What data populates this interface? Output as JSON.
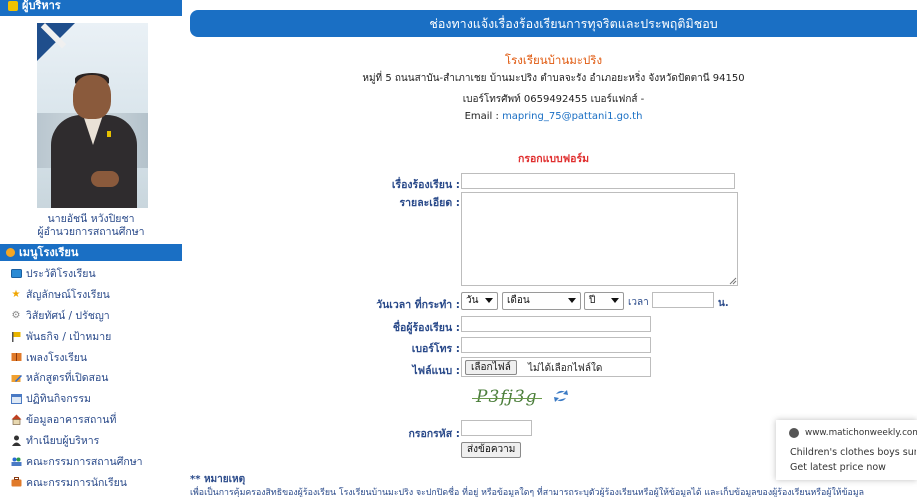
{
  "sidebar": {
    "admin_header": "ผู้บริหาร",
    "director_name": "นายอัชนี หวังปิยชา",
    "director_title": "ผู้อำนวยการสถานศึกษา",
    "menu_header": "เมนูโรงเรียน",
    "menu_items": [
      {
        "label": "ประวัติโรงเรียน",
        "icon": "card-icon"
      },
      {
        "label": "สัญลักษณ์โรงเรียน",
        "icon": "star-icon"
      },
      {
        "label": "วิสัยทัศน์ / ปรัชญา",
        "icon": "gear-icon"
      },
      {
        "label": "พันธกิจ / เป้าหมาย",
        "icon": "flag-icon"
      },
      {
        "label": "เพลงโรงเรียน",
        "icon": "music-book-icon"
      },
      {
        "label": "หลักสูตรที่เปิดสอน",
        "icon": "pencil-icon"
      },
      {
        "label": "ปฏิทินกิจกรรม",
        "icon": "calendar-icon"
      },
      {
        "label": "ข้อมูลอาคารสถานที่",
        "icon": "house-icon"
      },
      {
        "label": "ทำเนียบผู้บริหาร",
        "icon": "person-icon"
      },
      {
        "label": "คณะกรรมการสถานศึกษา",
        "icon": "group-icon"
      },
      {
        "label": "คณะกรรมการนักเรียน",
        "icon": "briefcase-icon"
      }
    ]
  },
  "banner": {
    "title": "ช่องทางแจ้งเรื่องร้องเรียนการทุจริตและประพฤติมิชอบ"
  },
  "school": {
    "name": "โรงเรียนบ้านมะปริง",
    "address": "หมู่ที่ 5 ถนนสาบัน-สำเภาเชย บ้านมะปริง ตำบลจะรัง อำเภอยะหริ่ง จังหวัดปัตตานี 94150",
    "phone": "เบอร์โทรศัพท์ 0659492455 เบอร์แฟกส์ -",
    "email_label": "Email :",
    "email": "mapring_75@pattani1.go.th"
  },
  "form": {
    "title": "กรอกแบบฟอร์ม",
    "subject_label": "เรื่องร้องเรียน :",
    "subject_value": "",
    "details_label": "รายละเอียด :",
    "details_value": "",
    "datetime_label": "วันเวลา ที่กระทำ :",
    "day_value": "วัน",
    "month_value": "เดือน",
    "year_value": "ปี",
    "time_label": "เวลา",
    "time_value": "",
    "time_unit": "น.",
    "name_label": "ชื่อผู้ร้องเรียน :",
    "name_value": "",
    "phone_label": "เบอร์โทร :",
    "phone_value": "",
    "attachment_label": "ไฟล์แนบ :",
    "file_button": "เลือกไฟล์",
    "file_status": "ไม่ได้เลือกไฟล์ใด",
    "captcha_text": "P3fj3g",
    "code_label": "กรอกรหัส :",
    "code_value": "",
    "submit_label": "ส่งข้อความ"
  },
  "note": {
    "title": "** หมายเหตุ",
    "text": "เพื่อเป็นการคุ้มครองสิทธิของผู้ร้องเรียน โรงเรียนบ้านมะปริง จะปกปิดชื่อ ที่อยู่ หรือข้อมูลใดๆ ที่สามารถระบุตัวผู้ร้องเรียนหรือผู้ให้ข้อมูลได้ และเก็บข้อมูลของผู้ร้องเรียนหรือผู้ให้ข้อมูล"
  },
  "ad": {
    "site": "www.matichonweekly.com",
    "description": "Children's clothes boys summer",
    "cta": "Get latest price now"
  },
  "colors": {
    "accent_blue": "#1a6fc4",
    "school_name_orange": "#e05a10",
    "form_title_red": "#e03030",
    "label_navy": "#2a4a8a",
    "captcha_green": "#4a7d3a"
  }
}
